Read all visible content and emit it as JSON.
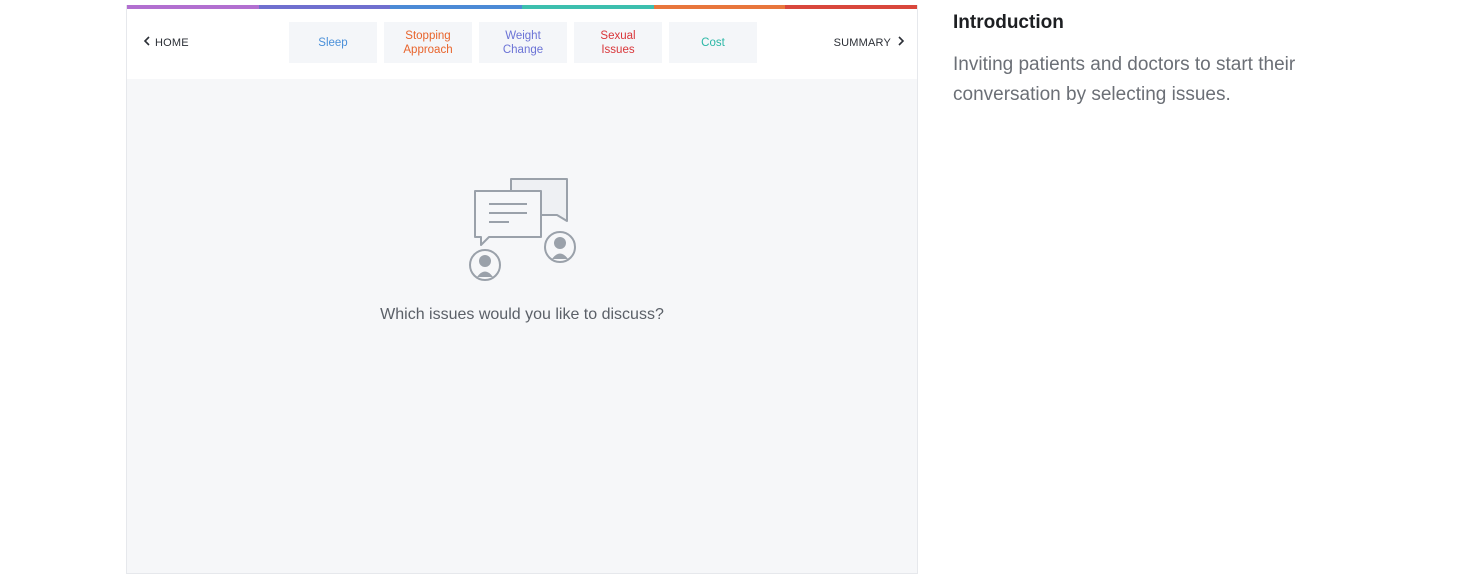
{
  "progress_colors": [
    "#b26fd0",
    "#6f6fcf",
    "#4c8ad6",
    "#3dbfae",
    "#e8763c",
    "#d9473c"
  ],
  "nav": {
    "home_label": "HOME",
    "summary_label": "SUMMARY"
  },
  "tabs": [
    {
      "label": "Sleep",
      "color": "#4a90d9"
    },
    {
      "label": "Stopping\nApproach",
      "color": "#e8642c"
    },
    {
      "label": "Weight\nChange",
      "color": "#6b73d6"
    },
    {
      "label": "Sexual\nIssues",
      "color": "#d9363a"
    },
    {
      "label": "Cost",
      "color": "#2bb7a6"
    }
  ],
  "main": {
    "prompt": "Which issues would you like to discuss?",
    "icon": "conversation-icon"
  },
  "side": {
    "title": "Introduction",
    "description": "Inviting patients and doctors to start their conversation by selecting issues."
  }
}
